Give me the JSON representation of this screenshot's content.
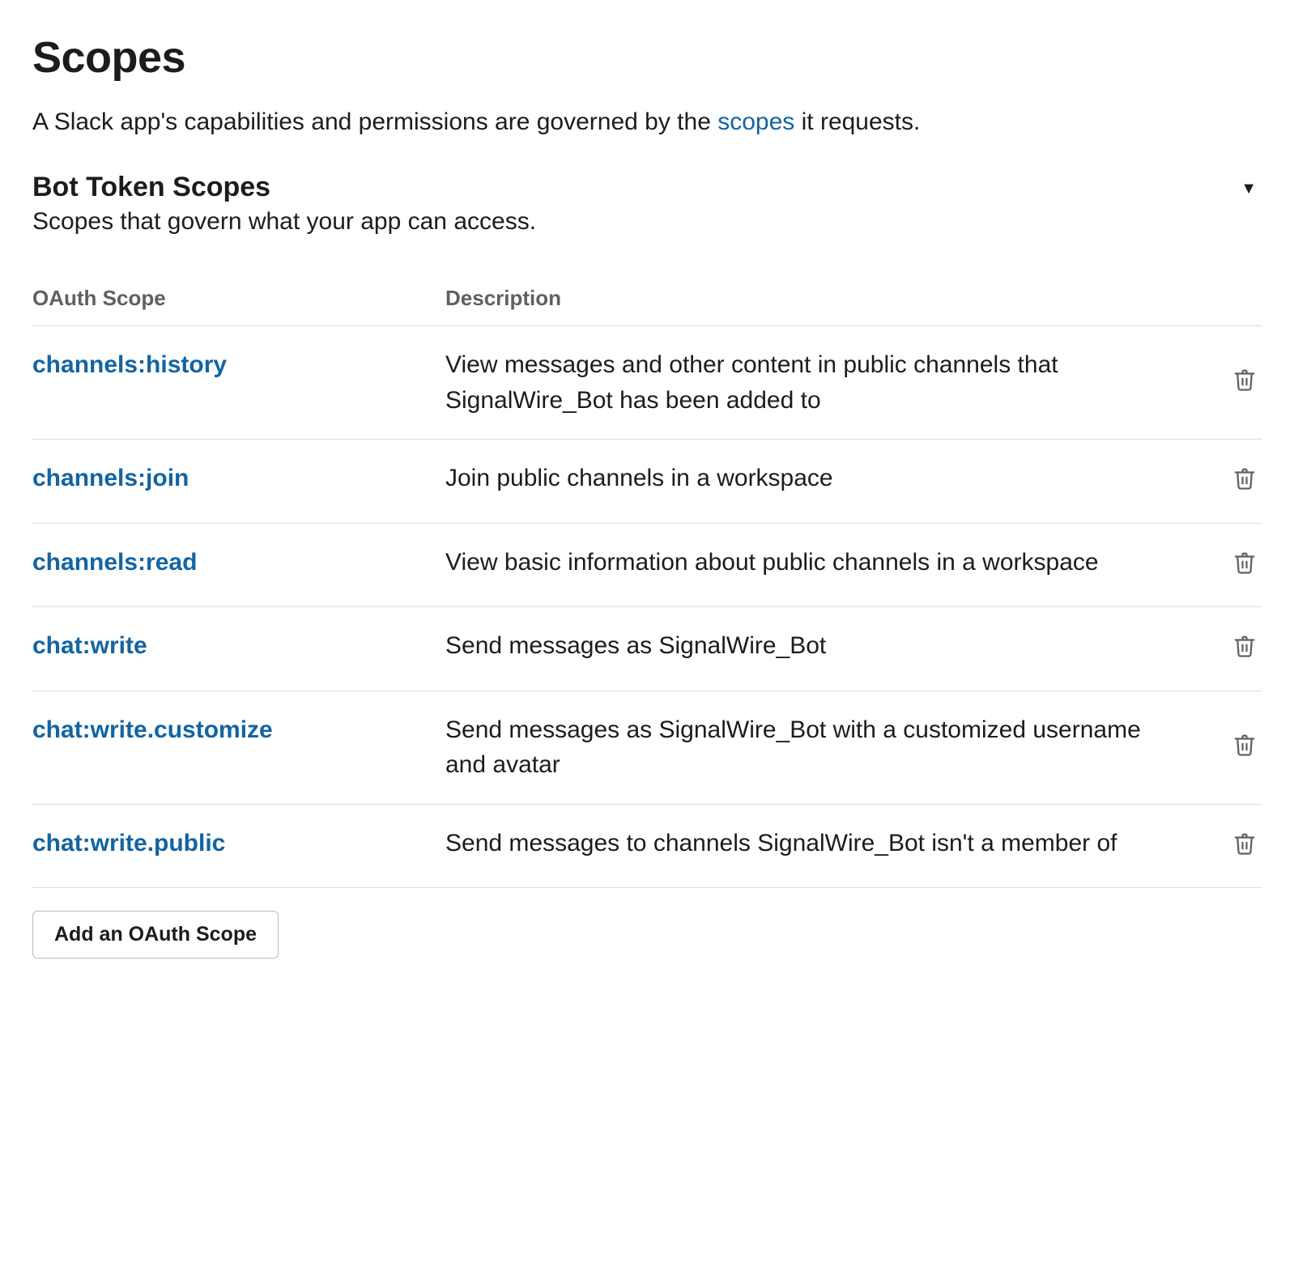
{
  "page": {
    "title": "Scopes",
    "subtitle_pre": "A Slack app's capabilities and permissions are governed by the ",
    "subtitle_link": "scopes",
    "subtitle_post": " it requests."
  },
  "section": {
    "title": "Bot Token Scopes",
    "description": "Scopes that govern what your app can access."
  },
  "table": {
    "header_scope": "OAuth Scope",
    "header_desc": "Description",
    "rows": [
      {
        "scope": "channels:history",
        "description": "View messages and other content in public channels that SignalWire_Bot has been added to"
      },
      {
        "scope": "channels:join",
        "description": "Join public channels in a workspace"
      },
      {
        "scope": "channels:read",
        "description": "View basic information about public channels in a workspace"
      },
      {
        "scope": "chat:write",
        "description": "Send messages as SignalWire_Bot"
      },
      {
        "scope": "chat:write.customize",
        "description": "Send messages as SignalWire_Bot with a customized username and avatar"
      },
      {
        "scope": "chat:write.public",
        "description": "Send messages to channels SignalWire_Bot isn't a member of"
      }
    ]
  },
  "buttons": {
    "add_scope": "Add an OAuth Scope"
  }
}
